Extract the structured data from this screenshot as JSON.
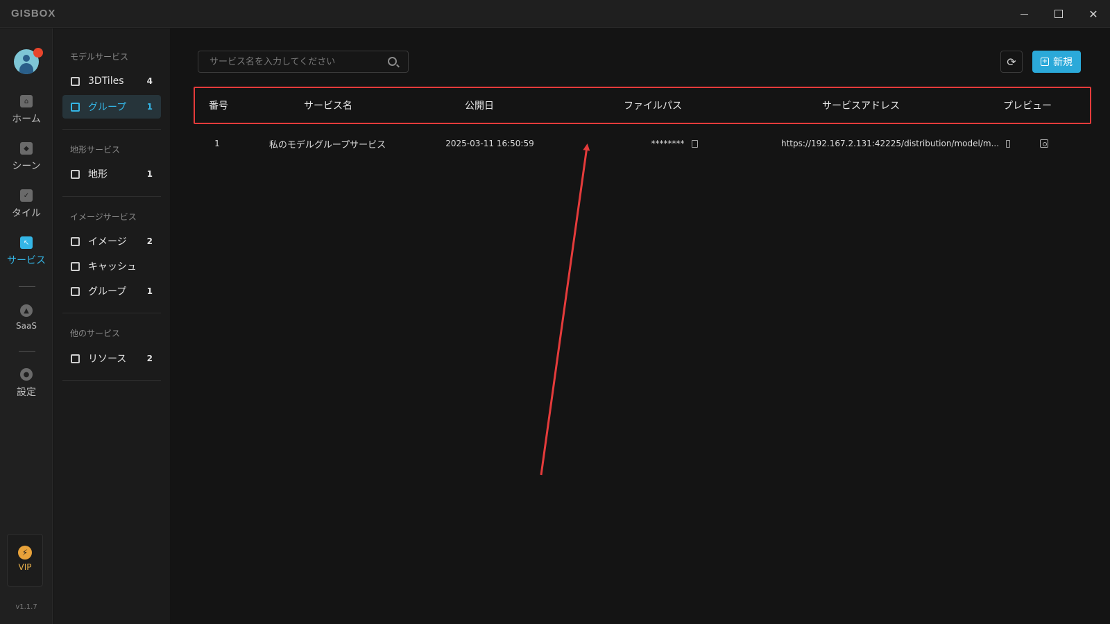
{
  "app": {
    "logo": "GISBOX",
    "version": "v1.1.7"
  },
  "window_controls": {
    "minimize": "minimize",
    "maximize": "maximize",
    "close": "close"
  },
  "rail": {
    "items": [
      {
        "label": "ホーム",
        "icon": "home-icon"
      },
      {
        "label": "シーン",
        "icon": "scene-icon"
      },
      {
        "label": "タイル",
        "icon": "tile-icon"
      },
      {
        "label": "サービス",
        "icon": "service-icon",
        "active": true
      },
      {
        "label": "SaaS",
        "icon": "saas-icon"
      },
      {
        "label": "設定",
        "icon": "settings-icon"
      }
    ],
    "vip_label": "VIP"
  },
  "subnav": {
    "sections": [
      {
        "title": "モデルサービス",
        "items": [
          {
            "label": "3DTiles",
            "count": "4"
          },
          {
            "label": "グループ",
            "count": "1",
            "active": true
          }
        ]
      },
      {
        "title": "地形サービス",
        "items": [
          {
            "label": "地形",
            "count": "1"
          }
        ]
      },
      {
        "title": "イメージサービス",
        "items": [
          {
            "label": "イメージ",
            "count": "2"
          },
          {
            "label": "キャッシュ",
            "count": ""
          },
          {
            "label": "グループ",
            "count": "1"
          }
        ]
      },
      {
        "title": "他のサービス",
        "items": [
          {
            "label": "リソース",
            "count": "2"
          }
        ]
      }
    ]
  },
  "toolbar": {
    "search_placeholder": "サービス名を入力してください",
    "new_label": "新規"
  },
  "table": {
    "headers": [
      "番号",
      "サービス名",
      "公開日",
      "ファイルパス",
      "サービスアドレス",
      "プレビュー"
    ],
    "rows": [
      {
        "index": "1",
        "name": "私のモデルグループサービス",
        "published": "2025-03-11 16:50:59",
        "file_path": "********",
        "address": "https://192.167.2.131:42225/distribution/model/m..."
      }
    ]
  },
  "colors": {
    "accent": "#34b6e6",
    "highlight_border": "#e53b3b",
    "annotation_arrow": "#e53b3b"
  }
}
